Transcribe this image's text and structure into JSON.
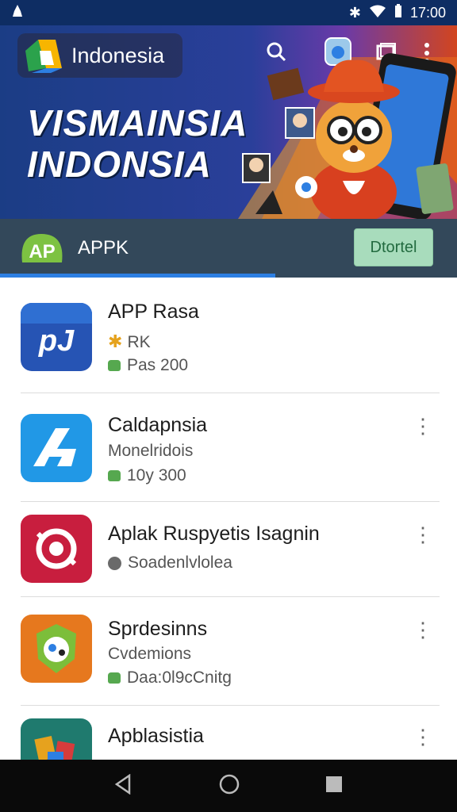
{
  "status_bar": {
    "time": "17:00"
  },
  "header": {
    "brand": "Indonesia",
    "headline_line1": "VISMAINSIA",
    "headline_line2": "INDONSIA"
  },
  "tabbar": {
    "label": "APPK",
    "logo_text": "AP",
    "button_label": "Dtortel"
  },
  "apps": [
    {
      "title": "APP Rasa",
      "line2": "RK",
      "line3": "Pas 200"
    },
    {
      "title": "Caldapnsia",
      "line2": "Monelridois",
      "line3": "10y 300"
    },
    {
      "title": "Aplak Ruspyetis Isagnin",
      "line2": "Soadenlvlolea",
      "line3": ""
    },
    {
      "title": "Sprdesinns",
      "line2": "Cvdemions",
      "line3": "Daa:0l9cCnitg"
    },
    {
      "title": "Apblasistia",
      "line2": "",
      "line3": ""
    }
  ],
  "colors": {
    "hero_bg": "#1c3f8a",
    "tabbar_bg": "#33485a",
    "accent": "#2d7fe2",
    "install_btn": "#a8dcbc"
  }
}
